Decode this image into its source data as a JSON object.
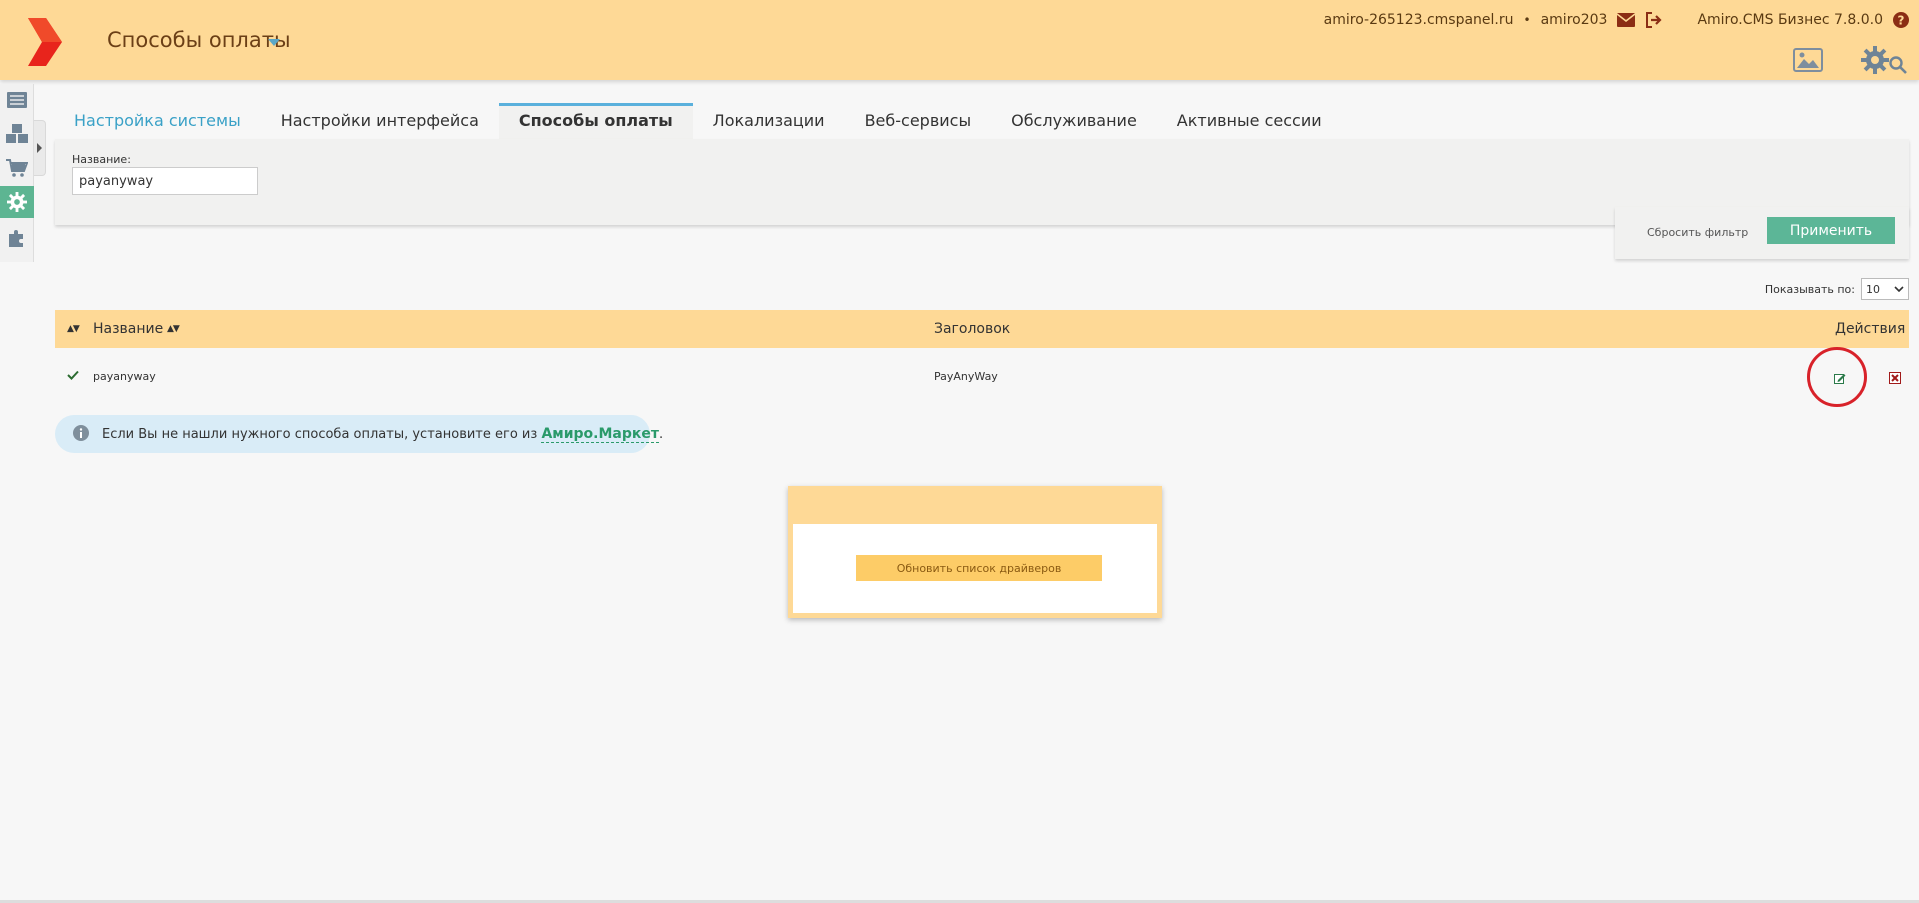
{
  "header": {
    "title": "Способы оплаты",
    "site": "amiro-265123.cmspanel.ru",
    "separator": "•",
    "user": "amiro203",
    "version": "Amiro.CMS Бизнес 7.8.0.0",
    "icons": [
      "mail-icon",
      "logout-icon",
      "help-icon",
      "gallery-icon",
      "settings-icon",
      "search-icon"
    ]
  },
  "sidebar": {
    "items": [
      {
        "icon": "list-icon"
      },
      {
        "icon": "boxes-icon"
      },
      {
        "icon": "cart-icon"
      },
      {
        "icon": "gear-icon",
        "active": true
      },
      {
        "icon": "puzzle-icon"
      }
    ]
  },
  "tabs": [
    {
      "label": "Настройка системы"
    },
    {
      "label": "Настройки интерфейса"
    },
    {
      "label": "Способы оплаты",
      "active": true
    },
    {
      "label": "Локализации"
    },
    {
      "label": "Веб-сервисы"
    },
    {
      "label": "Обслуживание"
    },
    {
      "label": "Активные сессии"
    }
  ],
  "filter": {
    "name_label": "Название:",
    "name_value": "payanyway",
    "reset_label": "Сбросить фильтр",
    "apply_label": "Применить"
  },
  "pagination": {
    "per_page_label": "Показывать по:",
    "per_page_value": "10"
  },
  "table": {
    "columns": {
      "name": "Название",
      "title": "Заголовок",
      "actions": "Действия"
    },
    "rows": [
      {
        "name": "payanyway",
        "title": "PayAnyWay",
        "active": true
      }
    ]
  },
  "info": {
    "text": "Если Вы не нашли нужного способа оплаты, установите его из",
    "link": "Амиро.Маркет",
    "suffix": "."
  },
  "drivers": {
    "button_label": "Обновить список драйверов"
  },
  "colors": {
    "header_bg": "#fed996",
    "accent_green": "#5cb697",
    "tab_link": "#3aa1c7",
    "highlight_red": "#d8222a"
  }
}
